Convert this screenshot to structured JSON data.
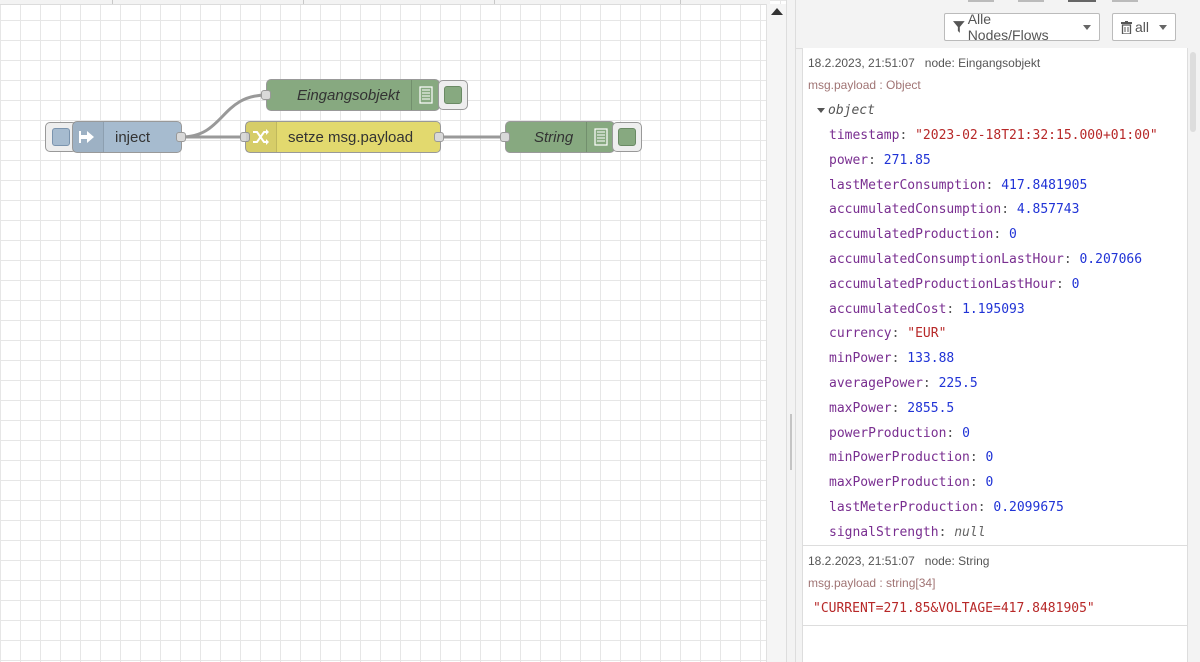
{
  "workspace": {
    "nodes": {
      "inject": {
        "label": "inject",
        "icon": "arrow-in-icon",
        "color": "#a6bbcf"
      },
      "change": {
        "label": "setze msg.payload",
        "icon": "shuffle-icon",
        "color": "#e2d96e"
      },
      "debug_obj": {
        "label": "Eingangsobjekt",
        "icon": "list-icon",
        "color": "#87a980"
      },
      "debug_str": {
        "label": "String",
        "icon": "list-icon",
        "color": "#87a980"
      }
    }
  },
  "sidebar": {
    "filter_label": "Alle Nodes/Flows",
    "clear_label": "all",
    "messages": [
      {
        "date": "18.2.2023, 21:51:07",
        "node": "node: Eingangsobjekt",
        "topic": "msg.payload : Object",
        "object_label": "object",
        "props": [
          {
            "key": "timestamp",
            "value": "\"2023-02-18T21:32:15.000+01:00\"",
            "kind": "string"
          },
          {
            "key": "power",
            "value": "271.85",
            "kind": "number"
          },
          {
            "key": "lastMeterConsumption",
            "value": "417.8481905",
            "kind": "number"
          },
          {
            "key": "accumulatedConsumption",
            "value": "4.857743",
            "kind": "number"
          },
          {
            "key": "accumulatedProduction",
            "value": "0",
            "kind": "number"
          },
          {
            "key": "accumulatedConsumptionLastHour",
            "value": "0.207066",
            "kind": "number"
          },
          {
            "key": "accumulatedProductionLastHour",
            "value": "0",
            "kind": "number"
          },
          {
            "key": "accumulatedCost",
            "value": "1.195093",
            "kind": "number"
          },
          {
            "key": "currency",
            "value": "\"EUR\"",
            "kind": "string"
          },
          {
            "key": "minPower",
            "value": "133.88",
            "kind": "number"
          },
          {
            "key": "averagePower",
            "value": "225.5",
            "kind": "number"
          },
          {
            "key": "maxPower",
            "value": "2855.5",
            "kind": "number"
          },
          {
            "key": "powerProduction",
            "value": "0",
            "kind": "number"
          },
          {
            "key": "minPowerProduction",
            "value": "0",
            "kind": "number"
          },
          {
            "key": "maxPowerProduction",
            "value": "0",
            "kind": "number"
          },
          {
            "key": "lastMeterProduction",
            "value": "0.2099675",
            "kind": "number"
          },
          {
            "key": "signalStrength",
            "value": "null",
            "kind": "null"
          }
        ]
      },
      {
        "date": "18.2.2023, 21:51:07",
        "node": "node: String",
        "topic": "msg.payload : string[34]",
        "value": "\"CURRENT=271.85&VOLTAGE=417.8481905\""
      }
    ]
  }
}
